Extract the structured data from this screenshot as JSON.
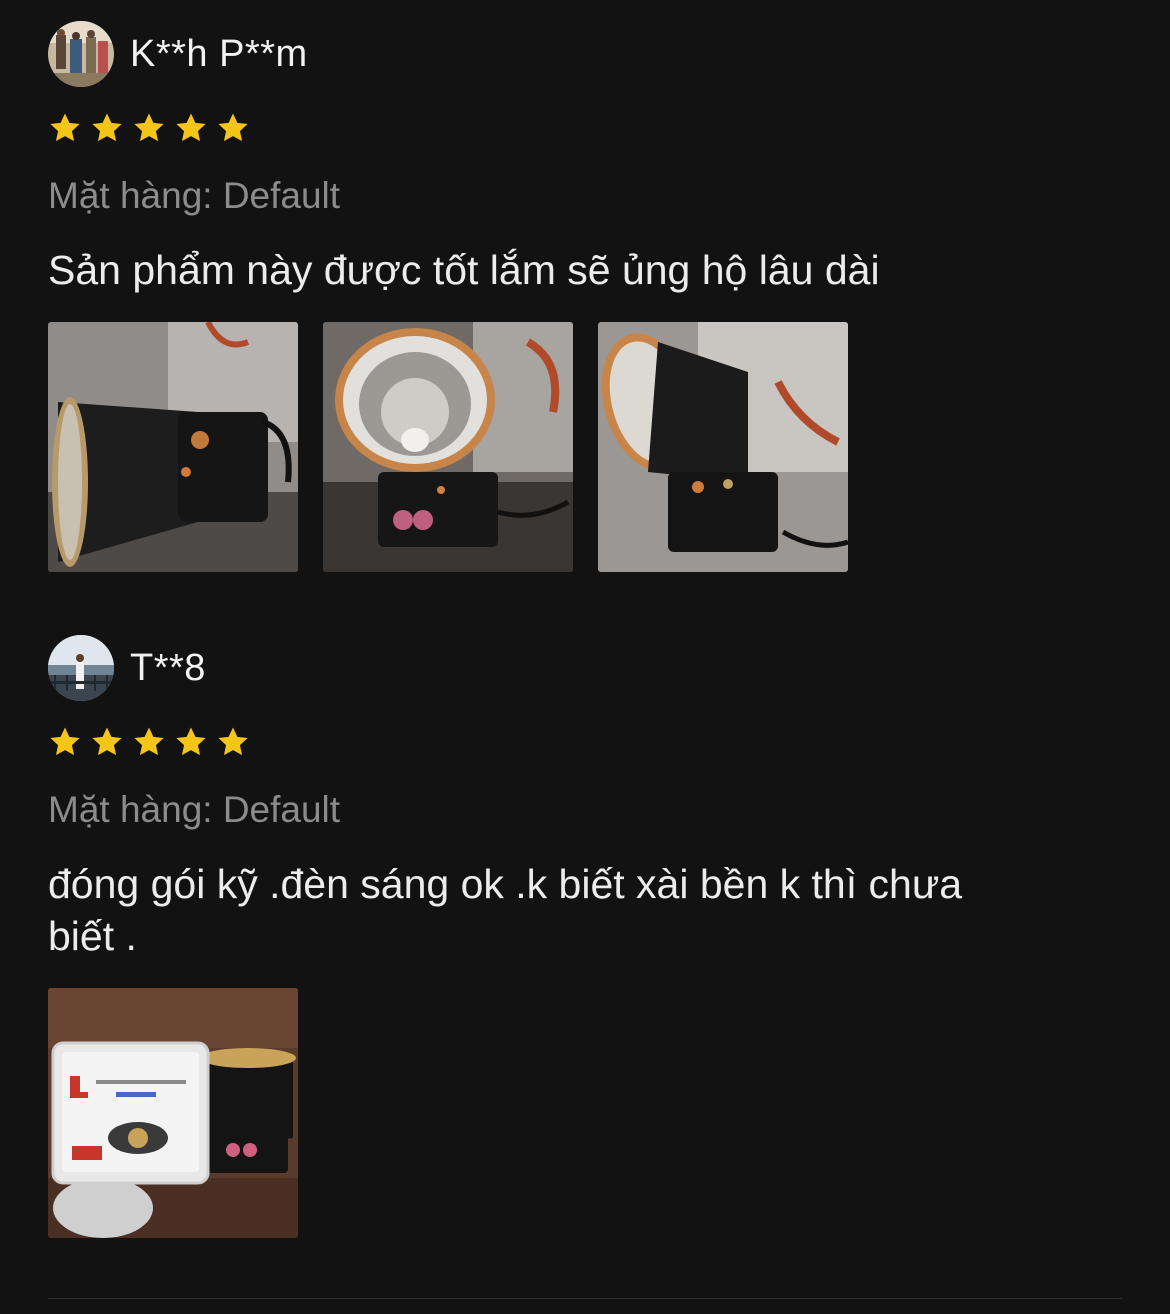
{
  "reviews": [
    {
      "reviewer": "K**h P**m",
      "rating": 5,
      "variation": "Mặt hàng: Default",
      "comment": "Sản phẩm này được tốt lắm sẽ ủng hộ lâu dài",
      "photo_count": 3
    },
    {
      "reviewer": "T**8",
      "rating": 5,
      "variation": "Mặt hàng: Default",
      "comment": "đóng gói kỹ .đèn sáng ok .k biết xài bền k thì chưa biết .",
      "photo_count": 1
    }
  ],
  "colors": {
    "background": "#121212",
    "star": "#f5c518",
    "variation_text": "#8c8c8c",
    "body_text": "#ececec"
  },
  "icons": {
    "star": "star-icon",
    "avatar": "avatar"
  }
}
